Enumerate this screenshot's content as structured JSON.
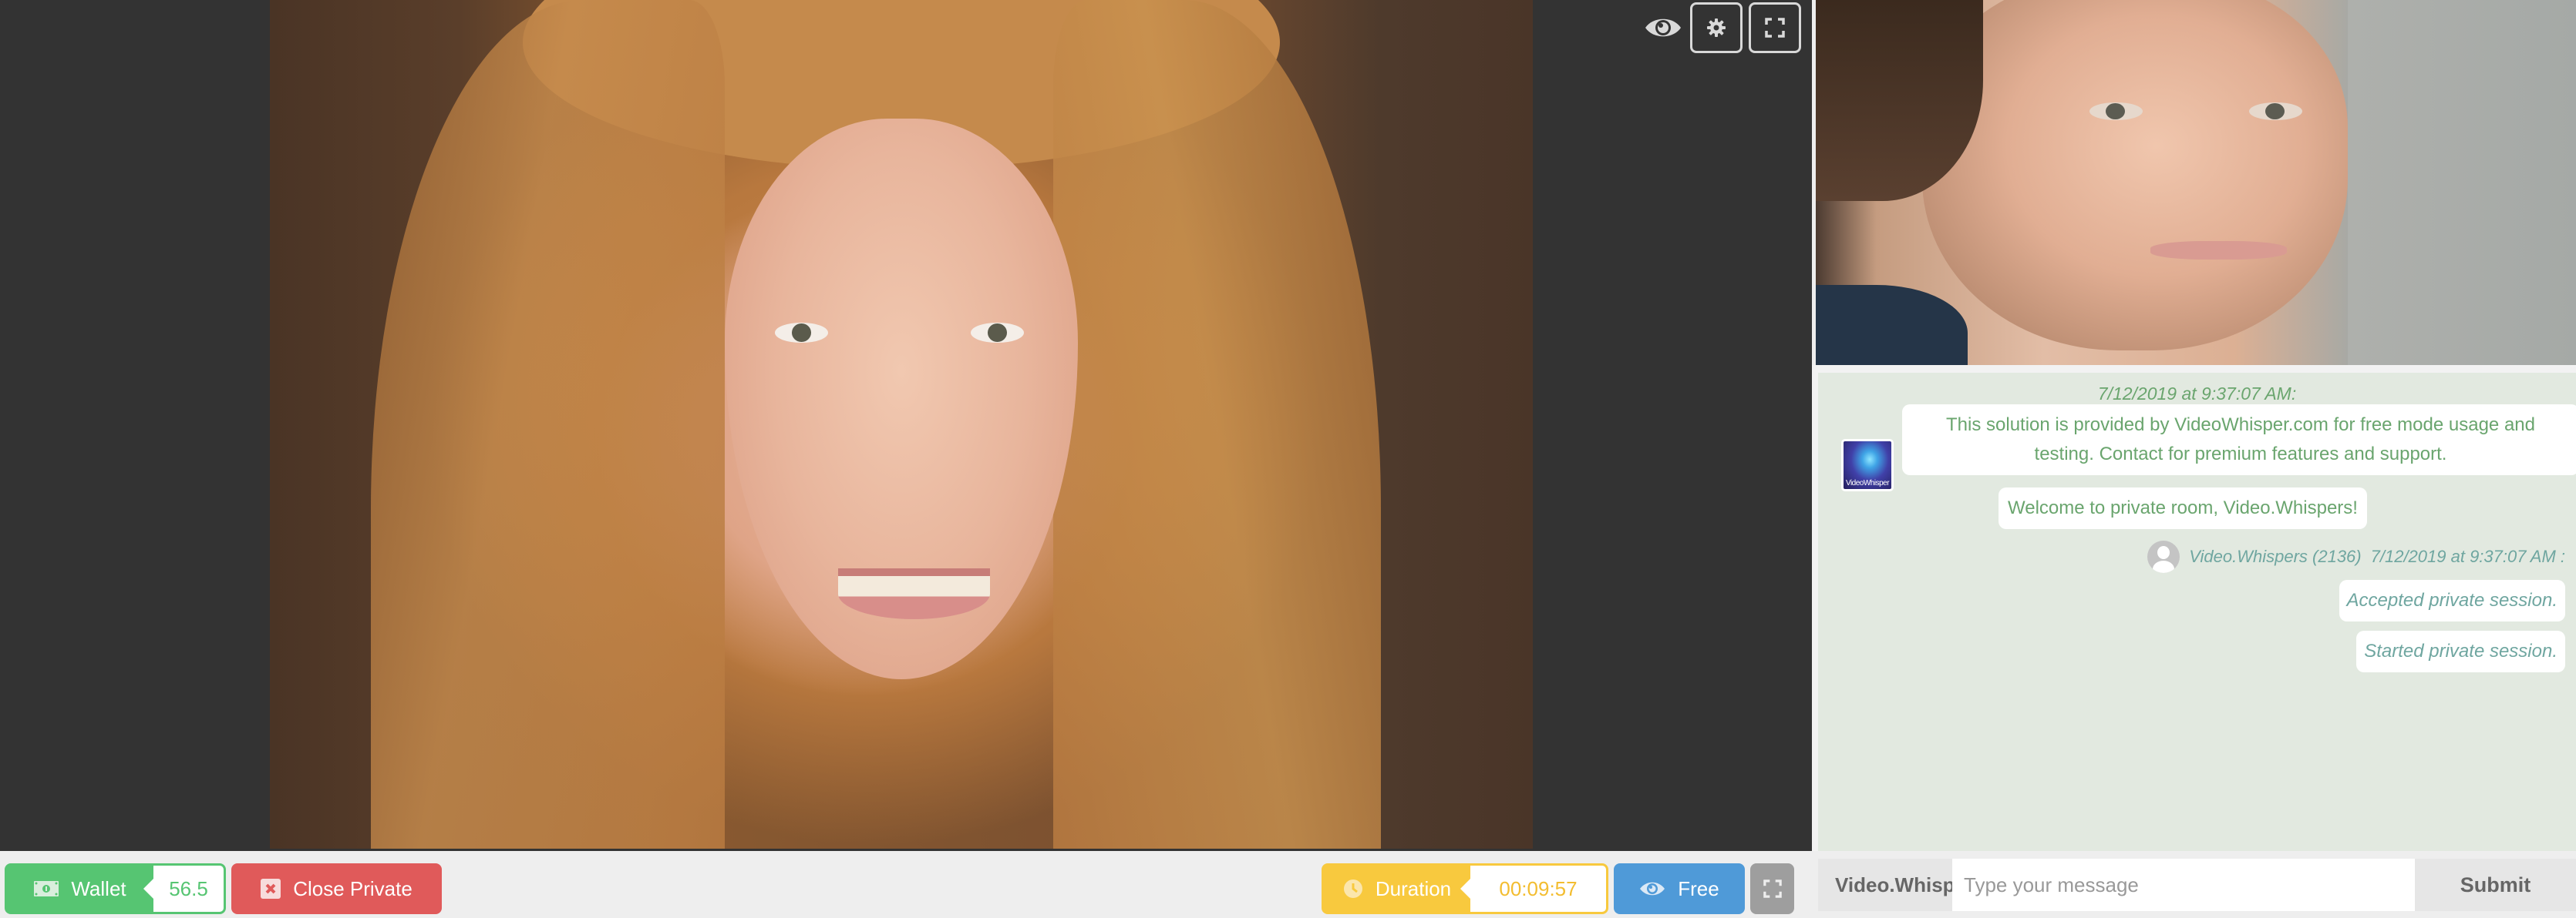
{
  "main_video": {
    "label": "Performer video stream",
    "controls": {
      "visibility_icon": "eye-icon",
      "settings_icon": "gear-icon",
      "fullscreen_icon": "expand-icon"
    }
  },
  "remote_video": {
    "label": "Client camera stream"
  },
  "chat": {
    "header_timestamp": "7/12/2019 at 9:37:07 AM:",
    "system_avatar_text": "VideoWhisper",
    "messages": [
      {
        "type": "system",
        "text": "This solution is provided by VideoWhisper.com for free mode usage and testing. Contact for premium features and support."
      },
      {
        "type": "system",
        "text": "Welcome to private room, Video.Whispers!"
      }
    ],
    "user_header": {
      "username": "Video.Whispers (2136)",
      "timestamp": "7/12/2019 at 9:37:07 AM :"
    },
    "user_messages": [
      {
        "text": "Accepted private session."
      },
      {
        "text": "Started private session."
      }
    ],
    "input": {
      "username_label": "Video.Whispers",
      "placeholder": "Type your message",
      "value": "",
      "submit_label": "Submit"
    }
  },
  "toolbar": {
    "wallet": {
      "label": "Wallet",
      "value": "56.5",
      "icon": "money-icon",
      "color": "#56c572"
    },
    "close_private": {
      "label": "Close Private",
      "icon": "close-box-icon",
      "color": "#e05a5a"
    },
    "duration": {
      "label": "Duration",
      "value": "00:09:57",
      "icon": "clock-icon",
      "color": "#f8c93e"
    },
    "free": {
      "label": "Free",
      "icon": "eye-icon",
      "color": "#4f9ad8"
    },
    "fullscreen": {
      "icon": "expand-icon",
      "color": "#9e9e9e"
    }
  },
  "colors": {
    "background_dark": "#333333",
    "chat_background": "#e2e9e0",
    "chat_system_text": "#6aa56e",
    "chat_user_text": "#6fa6a0"
  }
}
